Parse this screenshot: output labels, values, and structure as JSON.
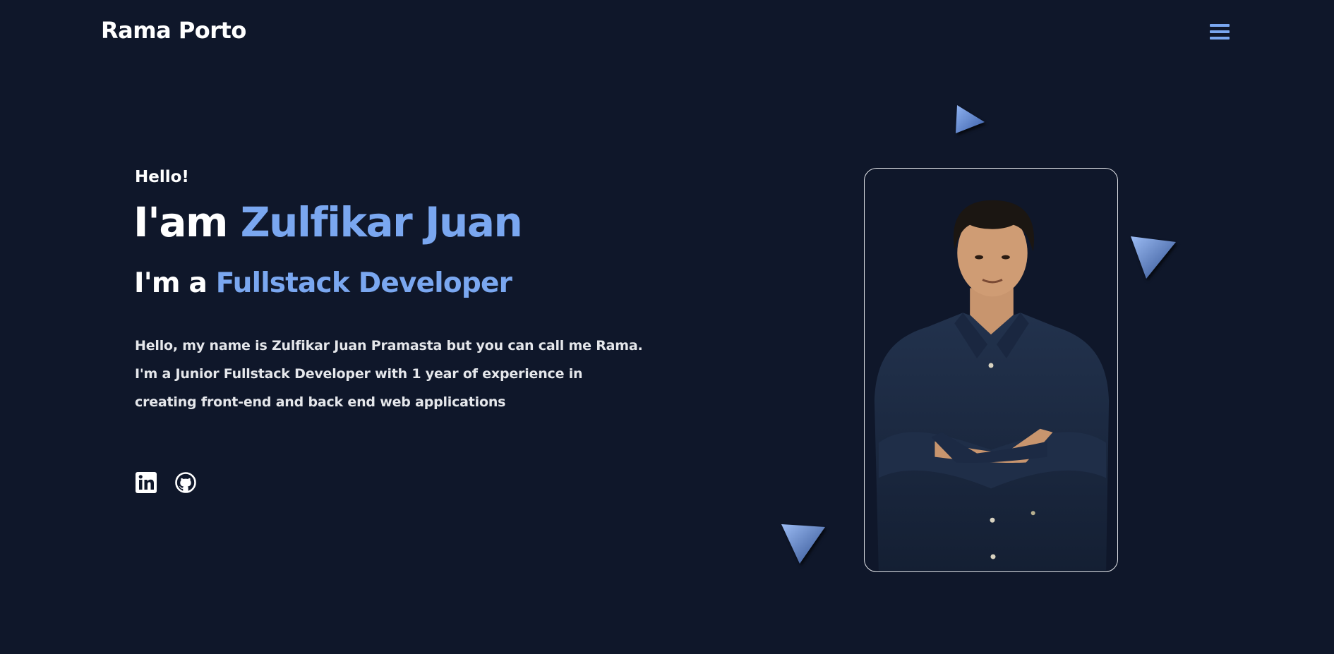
{
  "header": {
    "brand": "Rama Porto",
    "menu_icon": "hamburger-menu-icon"
  },
  "hero": {
    "greeting": "Hello!",
    "headline_prefix": "I'am ",
    "headline_name": "Zulfikar Juan",
    "subhead_prefix": "I'm a ",
    "subhead_role": "Fullstack Developer",
    "intro": "Hello, my name is Zulfikar Juan Pramasta but you can call me Rama. I'm a Junior Fullstack Developer with 1 year of experience in creating front-end and back end web applications"
  },
  "social": [
    {
      "icon": "linkedin-icon"
    },
    {
      "icon": "github-icon"
    }
  ],
  "photo": {
    "icon": "profile-photo"
  },
  "colors": {
    "background": "#0f172a",
    "accent": "#7aa7f0",
    "text": "#ffffff",
    "muted_text": "#e5e7eb",
    "shirt": "#1c2a40",
    "triangle": "#5c8ad8"
  }
}
